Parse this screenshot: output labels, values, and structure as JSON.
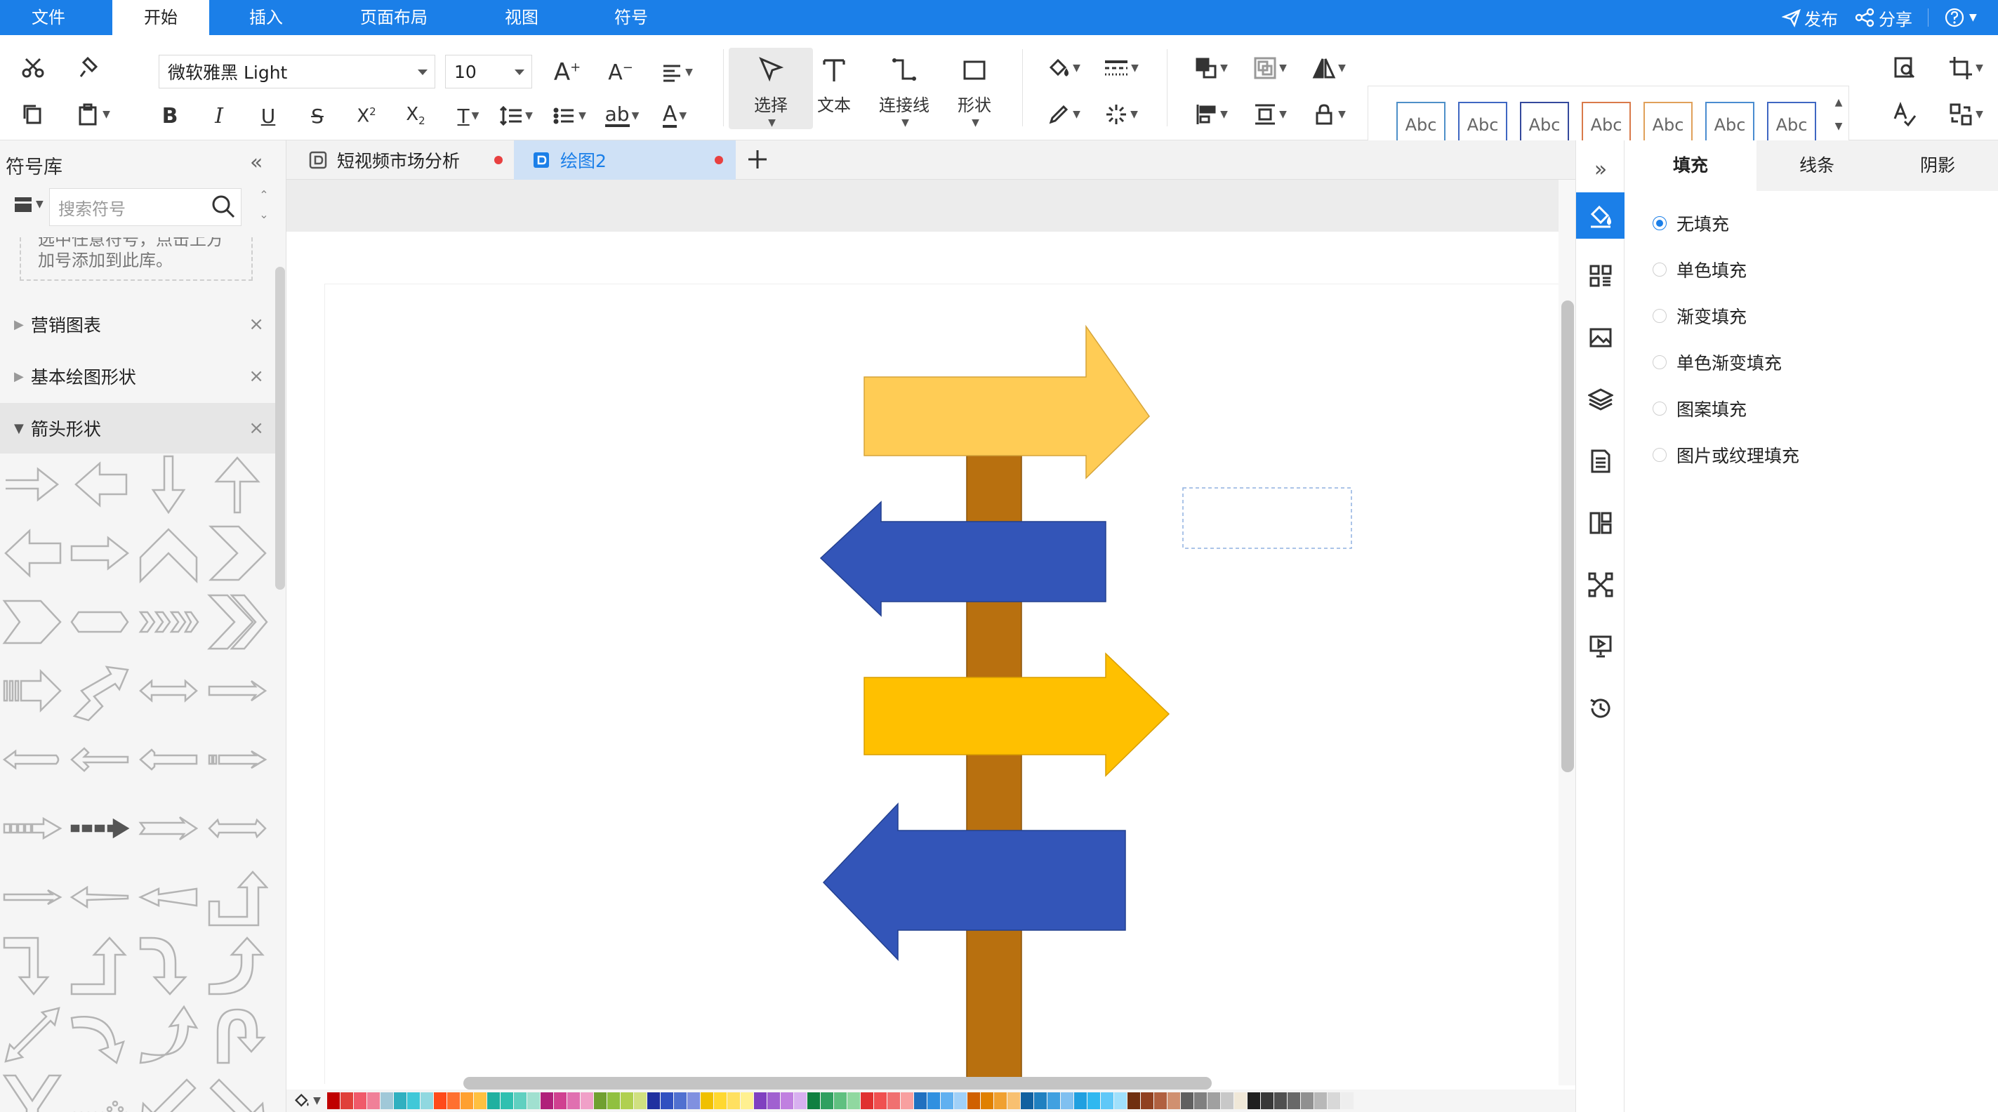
{
  "menu": {
    "tabs": [
      {
        "label": "文件"
      },
      {
        "label": "开始"
      },
      {
        "label": "插入"
      },
      {
        "label": "页面布局"
      },
      {
        "label": "视图"
      },
      {
        "label": "符号"
      }
    ],
    "active_tab": "开始",
    "publish_label": "发布",
    "share_label": "分享",
    "help_icon": "help-icon"
  },
  "ribbon": {
    "font_name": "微软雅黑 Light",
    "font_size": "10",
    "select_label": "选择",
    "text_label": "文本",
    "connector_label": "连接线",
    "shape_label": "形状",
    "style_presets": [
      {
        "label": "Abc",
        "color": "#4e8fc8"
      },
      {
        "label": "Abc",
        "color": "#3f67c2"
      },
      {
        "label": "Abc",
        "color": "#34499c"
      },
      {
        "label": "Abc",
        "color": "#d97a4a"
      },
      {
        "label": "Abc",
        "color": "#e0a05a"
      },
      {
        "label": "Abc",
        "color": "#4a8cd0"
      },
      {
        "label": "Abc",
        "color": "#3f67c2"
      }
    ]
  },
  "library": {
    "title": "符号库",
    "search_placeholder": "搜索符号",
    "hint_line1": "选中任意符号，点击上方",
    "hint_line2": "加号添加到此库。",
    "categories": [
      {
        "label": "营销图表",
        "expanded": false
      },
      {
        "label": "基本绘图形状",
        "expanded": false
      },
      {
        "label": "箭头形状",
        "expanded": true
      }
    ]
  },
  "documents": {
    "tabs": [
      {
        "label": "短视频市场分析",
        "active": false,
        "unsaved": true
      },
      {
        "label": "绘图2",
        "active": true,
        "unsaved": true
      }
    ],
    "add_icon": "plus-icon"
  },
  "canvas": {
    "signpost": {
      "post_color": "#b8700f",
      "arrows": [
        {
          "direction": "right",
          "color": "#ffcc55"
        },
        {
          "direction": "left",
          "color": "#3355b8"
        },
        {
          "direction": "right",
          "color": "#ffc000"
        },
        {
          "direction": "left",
          "color": "#3355b8"
        }
      ]
    },
    "palette": [
      "#c00000",
      "#e0403a",
      "#f05a6a",
      "#f08098",
      "#a0c8d8",
      "#30b0c0",
      "#40c8d8",
      "#90d8e0",
      "#ff4a1a",
      "#ff7030",
      "#ffa030",
      "#ffc040",
      "#20b0a0",
      "#30c0b0",
      "#60d0c0",
      "#a0e0d0",
      "#b0207a",
      "#d04090",
      "#e070b0",
      "#f0a0c8",
      "#70a030",
      "#90c040",
      "#b0d050",
      "#d0e080",
      "#2030a0",
      "#3050c0",
      "#5070d0",
      "#8090e0",
      "#f0c000",
      "#ffd830",
      "#ffe060",
      "#fff090",
      "#8040c0",
      "#a060d0",
      "#c080e0",
      "#d8b0f0",
      "#108040",
      "#30a060",
      "#60c080",
      "#90d8a0",
      "#e03030",
      "#f05050",
      "#f07070",
      "#f8a0a0",
      "#2070c0",
      "#3090e0",
      "#60b0f0",
      "#a0d0f8",
      "#d06000",
      "#e08000",
      "#f0a030",
      "#f8c070",
      "#1060a0",
      "#2080c0",
      "#40a0e0",
      "#80c0f0",
      "#20a0e0",
      "#30b8f0",
      "#60c8f8",
      "#a0e0fc",
      "#703010",
      "#904020",
      "#b06040",
      "#d09070",
      "#606060",
      "#808080",
      "#a0a0a0",
      "#c8c8c8",
      "#f0e8d8",
      "#202020",
      "#383838",
      "#505050",
      "#686868",
      "#909090",
      "#b8b8b8",
      "#d8d8d8",
      "#eeeeee"
    ]
  },
  "format_panel": {
    "tabs": [
      "填充",
      "线条",
      "阴影"
    ],
    "active_tab": "填充",
    "fill_options": [
      {
        "label": "无填充",
        "selected": true
      },
      {
        "label": "单色填充",
        "selected": false
      },
      {
        "label": "渐变填充",
        "selected": false
      },
      {
        "label": "单色渐变填充",
        "selected": false
      },
      {
        "label": "图案填充",
        "selected": false
      },
      {
        "label": "图片或纹理填充",
        "selected": false
      }
    ]
  },
  "side_icons": [
    "fill-icon",
    "grid-icon",
    "image-icon",
    "layers-icon",
    "page-icon",
    "layout-icon",
    "connect-icon",
    "present-icon",
    "history-icon"
  ]
}
